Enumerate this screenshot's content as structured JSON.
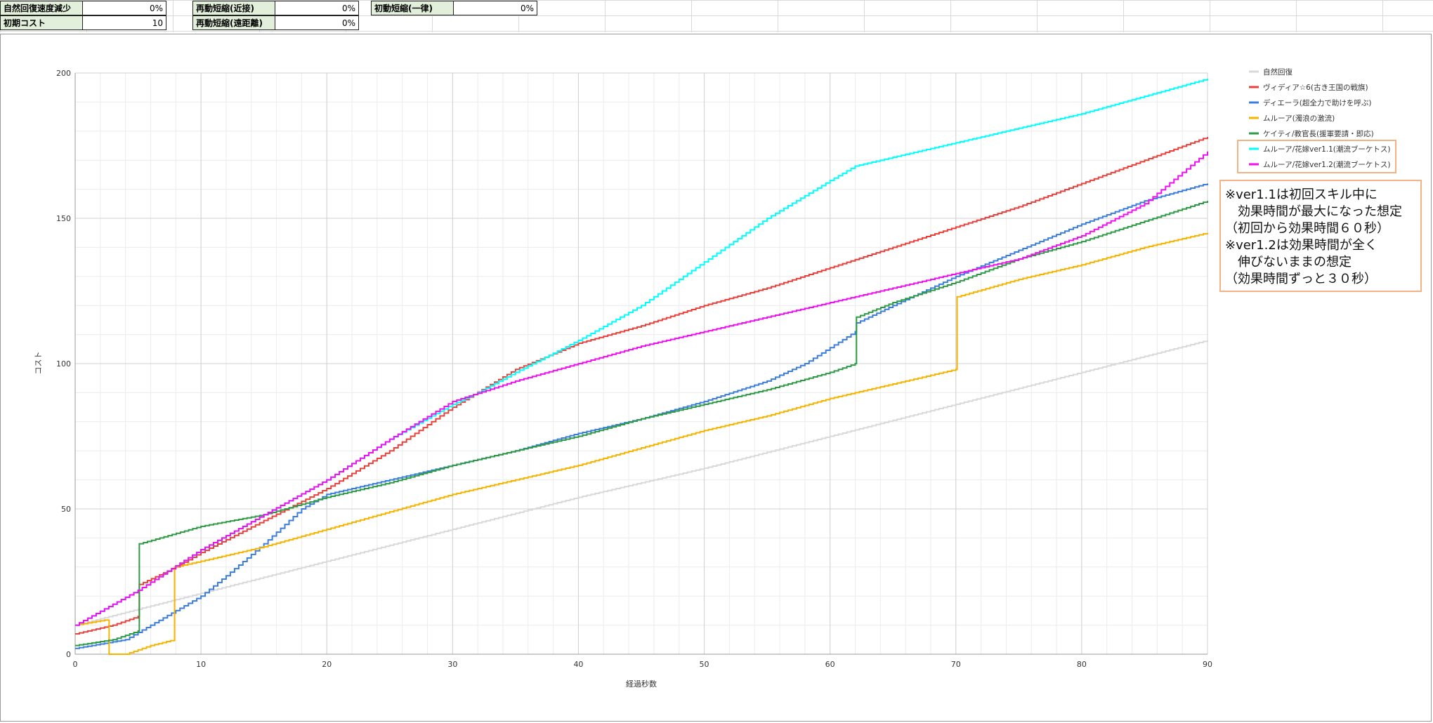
{
  "params": [
    {
      "label": "自然回復速度減少",
      "value": "0%"
    },
    {
      "label": "初期コスト",
      "value": "10"
    },
    {
      "label": "再動短縮(近接)",
      "value": "0%"
    },
    {
      "label": "再動短縮(遠距離)",
      "value": "0%"
    },
    {
      "label": "初動短縮(一律)",
      "value": "0%"
    }
  ],
  "chart_data": {
    "type": "line",
    "xlabel": "経過秒数",
    "ylabel": "コスト",
    "xlim": [
      0,
      90
    ],
    "ylim": [
      0,
      200
    ],
    "xticks": [
      0,
      10,
      20,
      30,
      40,
      50,
      60,
      70,
      80,
      90
    ],
    "yticks": [
      0,
      50,
      100,
      150,
      200
    ],
    "grid": true,
    "legend_position": "right",
    "series": [
      {
        "name": "自然回復",
        "color": "#d9d9d9",
        "points": [
          [
            0,
            10
          ],
          [
            20,
            32
          ],
          [
            40,
            54
          ],
          [
            50,
            64
          ],
          [
            60,
            75
          ],
          [
            70,
            86
          ],
          [
            80,
            97
          ],
          [
            90,
            108
          ]
        ]
      },
      {
        "name": "ヴィディア☆6(古き王国の戦旗)",
        "color": "#e8403a",
        "points": [
          [
            0,
            7
          ],
          [
            3,
            10
          ],
          [
            5,
            13
          ],
          [
            5.1,
            24
          ],
          [
            8,
            30
          ],
          [
            10,
            35
          ],
          [
            15,
            46
          ],
          [
            20,
            57
          ],
          [
            25,
            70
          ],
          [
            30,
            85
          ],
          [
            35,
            98
          ],
          [
            40,
            107
          ],
          [
            45,
            113
          ],
          [
            50,
            120
          ],
          [
            55,
            126
          ],
          [
            60,
            133
          ],
          [
            65,
            140
          ],
          [
            70,
            147
          ],
          [
            75,
            154
          ],
          [
            80,
            162
          ],
          [
            85,
            170
          ],
          [
            90,
            178
          ]
        ]
      },
      {
        "name": "ディエーラ(超全力で助けを呼ぶ)",
        "color": "#3b7ddd",
        "points": [
          [
            0,
            2
          ],
          [
            4,
            5
          ],
          [
            6,
            10
          ],
          [
            8,
            15
          ],
          [
            10,
            20
          ],
          [
            12,
            27
          ],
          [
            15,
            38
          ],
          [
            18,
            50
          ],
          [
            20,
            55
          ],
          [
            25,
            60
          ],
          [
            30,
            65
          ],
          [
            35,
            70
          ],
          [
            40,
            76
          ],
          [
            45,
            81
          ],
          [
            50,
            87
          ],
          [
            55,
            94
          ],
          [
            58,
            100
          ],
          [
            62,
            111
          ],
          [
            62.1,
            114
          ],
          [
            65,
            120
          ],
          [
            70,
            130
          ],
          [
            75,
            139
          ],
          [
            80,
            148
          ],
          [
            85,
            156
          ],
          [
            90,
            162
          ]
        ]
      },
      {
        "name": "ムルーア(濁浪の激流)",
        "color": "#f5b400",
        "points": [
          [
            0,
            10
          ],
          [
            2.7,
            12
          ],
          [
            2.7,
            0
          ],
          [
            4,
            0
          ],
          [
            6,
            3
          ],
          [
            7.9,
            5
          ],
          [
            7.9,
            30
          ],
          [
            10,
            32
          ],
          [
            15,
            37
          ],
          [
            20,
            43
          ],
          [
            25,
            49
          ],
          [
            30,
            55
          ],
          [
            35,
            60
          ],
          [
            40,
            65
          ],
          [
            45,
            71
          ],
          [
            50,
            77
          ],
          [
            55,
            82
          ],
          [
            60,
            88
          ],
          [
            65,
            93
          ],
          [
            70,
            98
          ],
          [
            70.1,
            123
          ],
          [
            75,
            129
          ],
          [
            80,
            134
          ],
          [
            85,
            140
          ],
          [
            90,
            145
          ]
        ]
      },
      {
        "name": "ケイティ/教官長(援軍要請・即応)",
        "color": "#2e9a45",
        "points": [
          [
            0,
            3
          ],
          [
            3,
            5
          ],
          [
            5,
            8
          ],
          [
            5.1,
            38
          ],
          [
            10,
            44
          ],
          [
            15,
            48
          ],
          [
            20,
            54
          ],
          [
            25,
            59
          ],
          [
            30,
            65
          ],
          [
            35,
            70
          ],
          [
            40,
            75
          ],
          [
            45,
            81
          ],
          [
            50,
            86
          ],
          [
            55,
            91
          ],
          [
            60,
            97
          ],
          [
            62,
            100
          ],
          [
            62.1,
            116
          ],
          [
            65,
            121
          ],
          [
            70,
            128
          ],
          [
            75,
            136
          ],
          [
            80,
            142
          ],
          [
            85,
            149
          ],
          [
            90,
            156
          ]
        ]
      },
      {
        "name": "ムルーア/花嫁ver1.1(潮流ブーケトス)",
        "color": "#00ffff",
        "points": [
          [
            0,
            10
          ],
          [
            5,
            22
          ],
          [
            10,
            36
          ],
          [
            15,
            48
          ],
          [
            20,
            60
          ],
          [
            25,
            74
          ],
          [
            30,
            86
          ],
          [
            32,
            90
          ],
          [
            35,
            97
          ],
          [
            40,
            108
          ],
          [
            45,
            120
          ],
          [
            50,
            135
          ],
          [
            55,
            150
          ],
          [
            60,
            163
          ],
          [
            62,
            168
          ],
          [
            65,
            171
          ],
          [
            70,
            176
          ],
          [
            75,
            181
          ],
          [
            80,
            186
          ],
          [
            85,
            192
          ],
          [
            90,
            198
          ]
        ]
      },
      {
        "name": "ムルーア/花嫁ver1.2(潮流ブーケトス)",
        "color": "#ee10ee",
        "points": [
          [
            0,
            10
          ],
          [
            5,
            22
          ],
          [
            10,
            36
          ],
          [
            15,
            48
          ],
          [
            20,
            60
          ],
          [
            25,
            74
          ],
          [
            30,
            87
          ],
          [
            35,
            94
          ],
          [
            40,
            100
          ],
          [
            45,
            106
          ],
          [
            50,
            111
          ],
          [
            55,
            116
          ],
          [
            60,
            121
          ],
          [
            65,
            126
          ],
          [
            70,
            131
          ],
          [
            75,
            136
          ],
          [
            80,
            144
          ],
          [
            85,
            155
          ],
          [
            90,
            173
          ]
        ]
      }
    ]
  },
  "note": {
    "lines": [
      "※ver1.1は初回スキル中に",
      "　効果時間が最大になった想定",
      "（初回から効果時間６０秒）",
      "※ver1.2は効果時間が全く",
      "　伸びないままの想定",
      "（効果時間ずっと３０秒）"
    ],
    "border_color": "#f4b183"
  }
}
